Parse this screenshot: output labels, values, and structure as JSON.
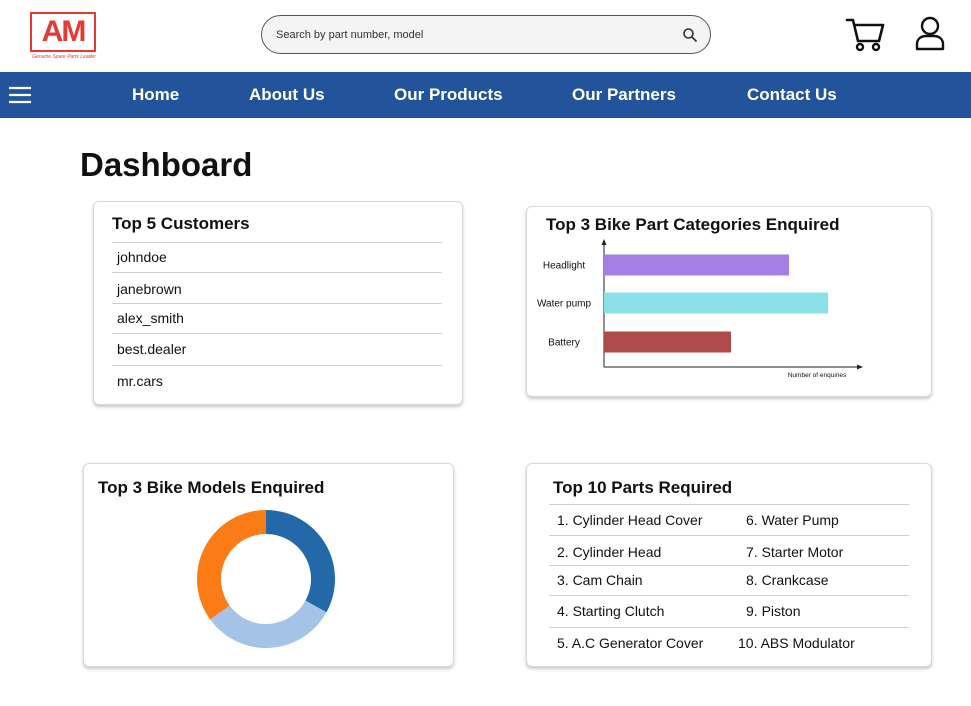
{
  "header": {
    "logo_text": "AM",
    "logo_tagline": "Genuine Spare Parts Leader",
    "search_placeholder": "Search by part number, model",
    "icons": {
      "search": "search-icon",
      "cart": "cart-icon",
      "user": "user-icon"
    }
  },
  "nav": {
    "menu_icon": "hamburger-icon",
    "items": [
      {
        "label": "Home"
      },
      {
        "label": "About Us"
      },
      {
        "label": "Our Products"
      },
      {
        "label": "Our Partners"
      },
      {
        "label": "Contact Us"
      }
    ]
  },
  "page": {
    "title": "Dashboard"
  },
  "customers": {
    "title": "Top 5 Customers",
    "items": [
      "johndoe",
      "janebrown",
      "alex_smith",
      "best.dealer",
      "mr.cars"
    ]
  },
  "categories_chart": {
    "title": "Top 3 Bike Part Categories Enquired"
  },
  "models_chart": {
    "title": "Top 3 Bike Models Enquired"
  },
  "parts": {
    "title": "Top 10 Parts Required",
    "items": [
      "1. Cylinder Head Cover",
      "2. Cylinder Head",
      "3. Cam Chain",
      "4. Starting Clutch",
      "5. A.C Generator Cover",
      "6. Water Pump",
      "7. Starter Motor",
      "8. Crankcase",
      "9. Piston",
      "10. ABS Modulator"
    ]
  },
  "colors": {
    "brand_red": "#e53935",
    "nav_blue": "#22539b",
    "bar_headlight": "#a57fe3",
    "bar_waterpump": "#8be0ea",
    "bar_battery": "#b04a4b",
    "donut_dark_blue": "#2369aa",
    "donut_light_blue": "#a5c2e7",
    "donut_orange": "#fb7b16"
  },
  "chart_data": [
    {
      "type": "bar",
      "orientation": "horizontal",
      "title": "Top 3 Bike Part Categories Enquired",
      "xlabel": "Number of enquiries",
      "ylabel": "",
      "categories": [
        "Headlight",
        "Water pump",
        "Battery"
      ],
      "values": [
        185,
        224,
        127
      ],
      "xlim": [
        0,
        258
      ],
      "grid": false,
      "colors": [
        "#a57fe3",
        "#8be0ea",
        "#b04a4b"
      ]
    },
    {
      "type": "pie",
      "donut": true,
      "title": "Top 3 Bike Models Enquired",
      "categories": [
        "",
        "",
        ""
      ],
      "values": [
        33,
        32,
        35
      ],
      "colors": [
        "#2369aa",
        "#a5c2e7",
        "#fb7b16"
      ]
    }
  ]
}
